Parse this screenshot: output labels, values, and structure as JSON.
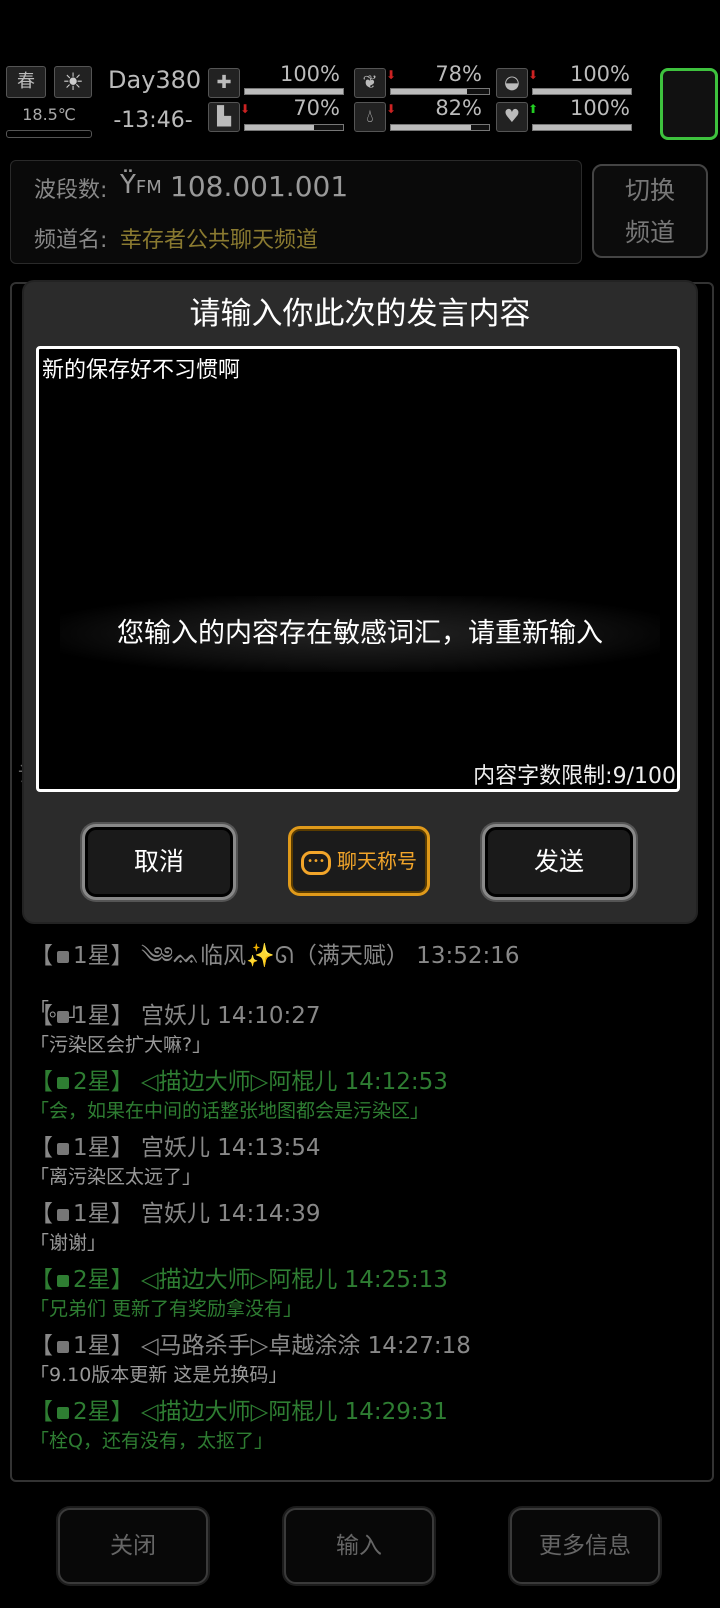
{
  "status": {
    "season": "春",
    "weather_icon": "sun-icon",
    "temperature": "18.5℃",
    "day": "Day380",
    "time": "-13:46-",
    "stats": [
      {
        "name": "health",
        "icon": "medkit-icon",
        "value": "100%",
        "level": 1.0
      },
      {
        "name": "stomach",
        "icon": "stomach-icon",
        "value": "78%",
        "level": 0.78,
        "trend": "down"
      },
      {
        "name": "oxygen",
        "icon": "mask-icon",
        "value": "100%",
        "level": 1.0,
        "trend": "down"
      },
      {
        "name": "stamina",
        "icon": "boot-icon",
        "value": "70%",
        "level": 0.7,
        "trend": "down"
      },
      {
        "name": "water",
        "icon": "water-drop-icon",
        "value": "82%",
        "level": 0.82,
        "trend": "down"
      },
      {
        "name": "mood",
        "icon": "heart-icon",
        "value": "100%",
        "level": 1.0,
        "trend": "up"
      }
    ]
  },
  "radio": {
    "band_label": "波段数:",
    "band_icon": "antenna-icon",
    "band_unit": "FM",
    "band_value": "108.001.001",
    "channel_label": "频道名:",
    "channel_name": "幸存者公共聊天频道",
    "switch_label_1": "切换",
    "switch_label_2": "频道"
  },
  "dialog": {
    "title": "请输入你此次的发言内容",
    "input_value": "新的保存好不习惯啊",
    "counter": "内容字数限制:9/100",
    "toast": "您输入的内容存在敏感词汇，请重新输入",
    "cancel": "取消",
    "chat_title": "聊天称号",
    "send": "发送"
  },
  "chat": {
    "stray_char": "记",
    "messages": [
      {
        "head": "1星】 ༄༅ᨐ临风✨ᘏ（满天赋） 13:52:16",
        "body": "「。。」",
        "color": "#888"
      },
      {
        "head": "1星】 宫妖儿 14:10:27",
        "body": "「污染区会扩大嘛?」",
        "color": "#888"
      },
      {
        "head": "2星】 ◁描边大师▷阿棍儿 14:12:53",
        "body": "「会，如果在中间的话整张地图都会是污染区」",
        "color": "#2e7d32"
      },
      {
        "head": "1星】 宫妖儿 14:13:54",
        "body": "「离污染区太远了」",
        "color": "#888"
      },
      {
        "head": "1星】 宫妖儿 14:14:39",
        "body": "「谢谢」",
        "color": "#888"
      },
      {
        "head": "2星】 ◁描边大师▷阿棍儿 14:25:13",
        "body": "「兄弟们 更新了有奖励拿没有」",
        "color": "#2e7d32"
      },
      {
        "head": "1星】 ◁马路杀手▷卓越涂涂 14:27:18",
        "body": "「9.10版本更新 这是兑换码」",
        "color": "#888"
      },
      {
        "head": "2星】 ◁描边大师▷阿棍儿 14:29:31",
        "body": "「栓Q，还有没有，太抠了」",
        "color": "#2e7d32"
      }
    ]
  },
  "bottom": {
    "close": "关闭",
    "input": "输入",
    "more": "更多信息"
  }
}
